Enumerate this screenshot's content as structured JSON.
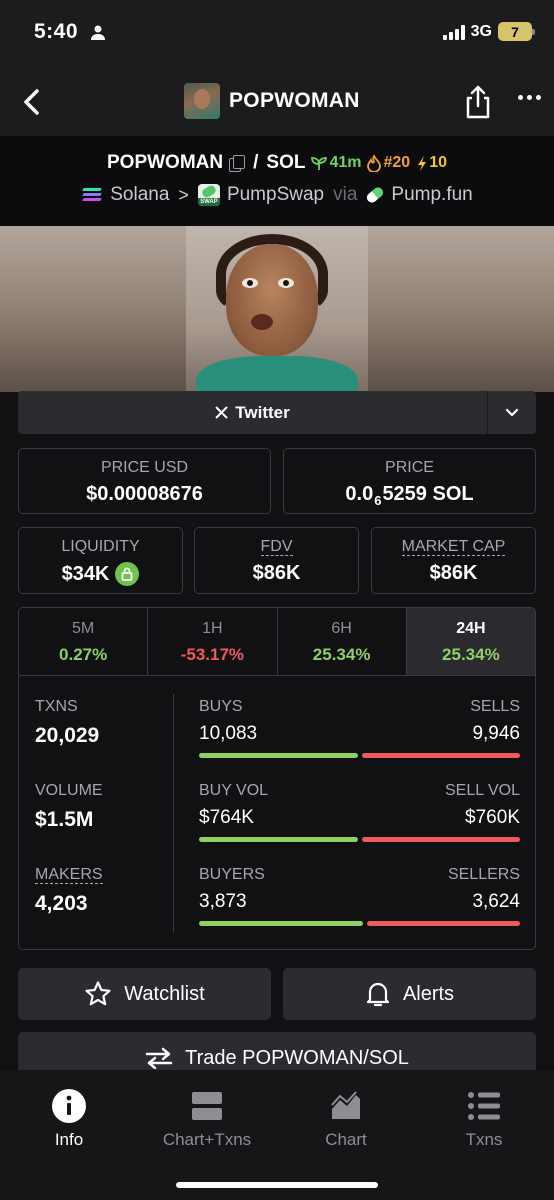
{
  "status_bar": {
    "time": "5:40",
    "network": "3G",
    "battery": "7"
  },
  "nav": {
    "title": "POPWOMAN"
  },
  "pair": {
    "base": "POPWOMAN",
    "separator": "/",
    "quote": "SOL",
    "age": "41m",
    "rank": "#20",
    "boosts": "10",
    "chain": "Solana",
    "dex": "PumpSwap",
    "via_label": "via",
    "launchpad": "Pump.fun"
  },
  "social": {
    "twitter_label": "Twitter"
  },
  "price": {
    "usd_label": "PRICE USD",
    "usd_value": "$0.00008676",
    "native_label": "PRICE",
    "native_prefix": "0.0",
    "native_zeros": "6",
    "native_digits": "5259 SOL"
  },
  "metrics": {
    "liquidity_label": "LIQUIDITY",
    "liquidity_value": "$34K",
    "fdv_label": "FDV",
    "fdv_value": "$86K",
    "mcap_label": "MARKET CAP",
    "mcap_value": "$86K"
  },
  "timeframes": [
    {
      "label": "5M",
      "value": "0.27%",
      "trend": "up"
    },
    {
      "label": "1H",
      "value": "-53.17%",
      "trend": "down"
    },
    {
      "label": "6H",
      "value": "25.34%",
      "trend": "up"
    },
    {
      "label": "24H",
      "value": "25.34%",
      "trend": "up",
      "active": true
    }
  ],
  "stats": {
    "txns_label": "TXNS",
    "txns_value": "20,029",
    "buys_label": "BUYS",
    "buys_value": "10,083",
    "sells_label": "SELLS",
    "sells_value": "9,946",
    "buys_share": 0.503,
    "volume_label": "VOLUME",
    "volume_value": "$1.5M",
    "buy_vol_label": "BUY VOL",
    "buy_vol_value": "$764K",
    "sell_vol_label": "SELL VOL",
    "sell_vol_value": "$760K",
    "buy_vol_share": 0.501,
    "makers_label": "MAKERS",
    "makers_value": "4,203",
    "buyers_label": "BUYERS",
    "buyers_value": "3,873",
    "sellers_label": "SELLERS",
    "sellers_value": "3,624",
    "buyers_share": 0.517
  },
  "actions": {
    "watchlist": "Watchlist",
    "alerts": "Alerts",
    "trade": "Trade POPWOMAN/SOL"
  },
  "tab_bar": {
    "info": "Info",
    "chart_txns": "Chart+Txns",
    "chart": "Chart",
    "txns": "Txns"
  },
  "colors": {
    "up": "#8ed065",
    "down": "#f05a5a",
    "age": "#6ed35a",
    "rank": "#f0a12b",
    "boost": "#f3c623"
  }
}
